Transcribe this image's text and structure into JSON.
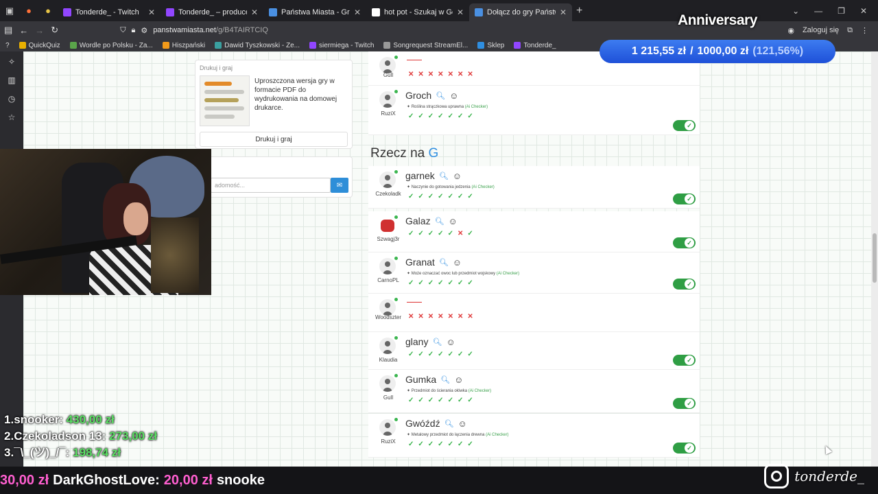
{
  "tabs": [
    {
      "label": "Tonderde_ - Twitch",
      "color": "#9146ff",
      "active": false
    },
    {
      "label": "Tonderde_ – producent wideo",
      "color": "#9146ff",
      "active": false
    },
    {
      "label": "Państwa Miasta - Gra online",
      "color": "#4a90e2",
      "active": false
    },
    {
      "label": "hot pot - Szukaj w Google",
      "color": "#ffffff",
      "active": false
    },
    {
      "label": "Dołącz do gry Państwa Miasta",
      "color": "#4a90e2",
      "active": true
    }
  ],
  "url": {
    "host": "panstwamiasta.net",
    "path": "/g/B4TAIRTCIQ"
  },
  "nav": {
    "login": "Zaloguj się"
  },
  "bookmarks": [
    {
      "label": "QuickQuiz",
      "color": "#e9b000"
    },
    {
      "label": "Wordle po Polsku - Za...",
      "color": "#5aa54a"
    },
    {
      "label": "Hiszpański",
      "color": "#f29a1a"
    },
    {
      "label": "Dawid Tyszkowski - Ze...",
      "color": "#3aa0a0"
    },
    {
      "label": "siermiega - Twitch",
      "color": "#9146ff"
    },
    {
      "label": "Songrequest StreamEl...",
      "color": "#999999"
    },
    {
      "label": "Sklep",
      "color": "#2f8ee0"
    },
    {
      "label": "Tonderde_",
      "color": "#9146ff"
    }
  ],
  "print_card": {
    "title": "Drukuj i graj",
    "text": "Uproszczona wersja gry w formacie PDF do wydrukowania na domowej drukarce.",
    "button": "Drukuj i graj"
  },
  "chat": {
    "placeholder": "adomość..."
  },
  "section": {
    "prefix": "Rzecz na",
    "letter": "G"
  },
  "rows_top": [
    {
      "user": "Gull",
      "word": "",
      "desc": "",
      "ai": "",
      "votes": "xxxxxxx",
      "toggle": false
    },
    {
      "user": "RuziX",
      "word": "Groch",
      "desc": "Roślina strączkowa uprawna",
      "ai": "(Ai Checker)",
      "votes": "vvvvvvv",
      "toggle": true
    }
  ],
  "rows": [
    {
      "user": "Czekoladk",
      "word": "garnek",
      "desc": "Naczynie do gotowania jedzenia",
      "ai": "(Ai Checker)",
      "votes": "vvvvvvv",
      "toggle": true
    },
    {
      "user": "Szwagj3r",
      "word": "Galaz",
      "desc": "",
      "ai": "",
      "votes": "vvvvvxv",
      "toggle": true,
      "red": true
    },
    {
      "user": "CarnoPL",
      "word": "Granat",
      "desc": "Może oznaczać owoc lub przedmiot wojskowy",
      "ai": "(Ai Checker)",
      "votes": "vvvvvvv",
      "toggle": true
    },
    {
      "user": "Woodszter",
      "word": "",
      "desc": "",
      "ai": "",
      "votes": "xxxxxxx",
      "toggle": false
    },
    {
      "user": "Klaudia",
      "word": "glany",
      "desc": "",
      "ai": "",
      "votes": "vvvvvvv",
      "toggle": true
    },
    {
      "user": "Gull",
      "word": "Gumka",
      "desc": "Przedmiot do ścierania ołówka",
      "ai": "(Ai Checker)",
      "votes": "vvvvvvv",
      "toggle": true
    },
    {
      "user": "RuziX",
      "word": "Gwóźdź",
      "desc": "Metalowy przedmiot do łączenia drewna",
      "ai": "(Ai Checker)",
      "votes": "vvvvvvv",
      "toggle": true
    }
  ],
  "overlay": {
    "anniversary": "Anniversary",
    "goal_current": "1 215,55 zł",
    "goal_sep": "/",
    "goal_target": "1000,00 zł",
    "goal_pct": "(121,56%)",
    "leaderboard": [
      {
        "rank": "1.",
        "name": "snooker:",
        "amount": "430,00 zł"
      },
      {
        "rank": "2.",
        "name": "Czekoladson 13:",
        "amount": "273,00 zł"
      },
      {
        "rank": "3.",
        "name": "¯\\_(ツ)_/¯:",
        "amount": "198,74 zł"
      }
    ],
    "ticker": [
      {
        "name": "",
        "amount": "30,00 zł"
      },
      {
        "name": "DarkGhostLove:",
        "amount": "20,00 zł"
      },
      {
        "name": "snooke",
        "amount": ""
      }
    ],
    "instagram": "tonderde_"
  }
}
